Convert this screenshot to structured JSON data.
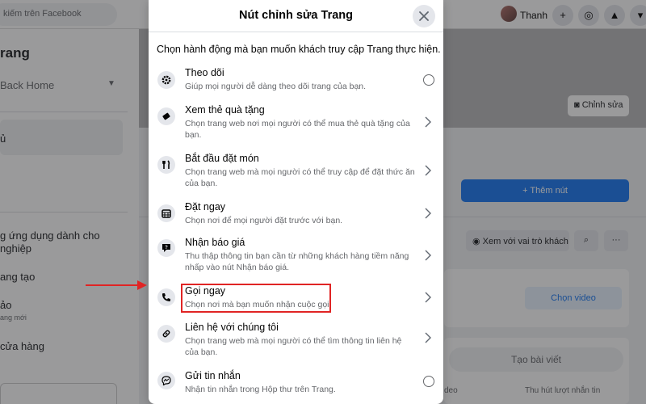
{
  "background": {
    "search_placeholder": "kiếm trên Facebook",
    "sidebar_title": "rang",
    "sidebar_back": "Back Home",
    "sidebar_item1": "ủ",
    "sidebar_item2_line1": "g ứng dụng dành cho",
    "sidebar_item2_line2": "nghiệp",
    "sidebar_item3": "ang tạo",
    "sidebar_item4": "ảo",
    "sidebar_item4_sub": "ang mới",
    "sidebar_item5": "cửa hàng",
    "user_name": "Thanh",
    "edit_cover": "Chỉnh sửa",
    "add_button": "+ Thêm nút",
    "view_as": "Xem với vai trò khách",
    "choose_video": "Chọn video",
    "create_post": "Tạo bài viết",
    "bottom_left": "deo",
    "bottom_right": "Thu hút lượt nhắn tin"
  },
  "modal": {
    "title": "Nút chỉnh sửa Trang",
    "subtitle": "Chọn hành động mà bạn muốn khách truy cập Trang thực hiện.",
    "options": [
      {
        "title": "Theo dõi",
        "desc": "Giúp mọi người dễ dàng theo dõi trang của bạn.",
        "icon": "follow-gear-icon",
        "control": "radio"
      },
      {
        "title": "Xem thẻ quà tặng",
        "desc": "Chọn trang web nơi mọi người có thể mua thẻ quà tặng của bạn.",
        "icon": "gift-card-icon",
        "control": "chevron"
      },
      {
        "title": "Bắt đầu đặt món",
        "desc": "Chọn trang web mà mọi người có thể truy cập để đặt thức ăn của bạn.",
        "icon": "utensils-icon",
        "control": "chevron"
      },
      {
        "title": "Đặt ngay",
        "desc": "Chọn nơi để mọi người đặt trước với bạn.",
        "icon": "calendar-icon",
        "control": "chevron"
      },
      {
        "title": "Nhận báo giá",
        "desc": "Thu thập thông tin bạn cần từ những khách hàng tiềm năng nhấp vào nút Nhận báo giá.",
        "icon": "quote-icon",
        "control": "chevron"
      },
      {
        "title": "Gọi ngay",
        "desc": "Chọn nơi mà bạn muốn nhận cuộc gọi.",
        "icon": "phone-icon",
        "control": "chevron"
      },
      {
        "title": "Liên hệ với chúng tôi",
        "desc": "Chọn trang web mà mọi người có thể tìm thông tin liên hệ của bạn.",
        "icon": "link-icon",
        "control": "chevron"
      },
      {
        "title": "Gửi tin nhắn",
        "desc": "Nhận tin nhắn trong Hộp thư trên Trang.",
        "icon": "messenger-icon",
        "control": "radio"
      }
    ]
  },
  "colors": {
    "highlight": "#e02424",
    "brand": "#1877f2"
  }
}
